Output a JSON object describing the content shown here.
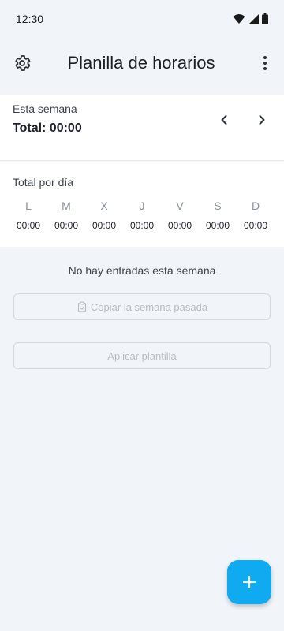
{
  "status_bar": {
    "time": "12:30"
  },
  "app_bar": {
    "title": "Planilla de horarios"
  },
  "week": {
    "label": "Esta semana",
    "total": "Total: 00:00"
  },
  "daily": {
    "title": "Total por día",
    "days": [
      {
        "letter": "L",
        "time": "00:00"
      },
      {
        "letter": "M",
        "time": "00:00"
      },
      {
        "letter": "X",
        "time": "00:00"
      },
      {
        "letter": "J",
        "time": "00:00"
      },
      {
        "letter": "V",
        "time": "00:00"
      },
      {
        "letter": "S",
        "time": "00:00"
      },
      {
        "letter": "D",
        "time": "00:00"
      }
    ]
  },
  "empty_state": {
    "message": "No hay entradas esta semana",
    "copy_button": "Copiar la semana pasada",
    "template_button": "Aplicar plantilla"
  },
  "colors": {
    "background": "#f1f5f9",
    "fab": "#10aaf0",
    "disabled_text": "#b7bcc2"
  }
}
